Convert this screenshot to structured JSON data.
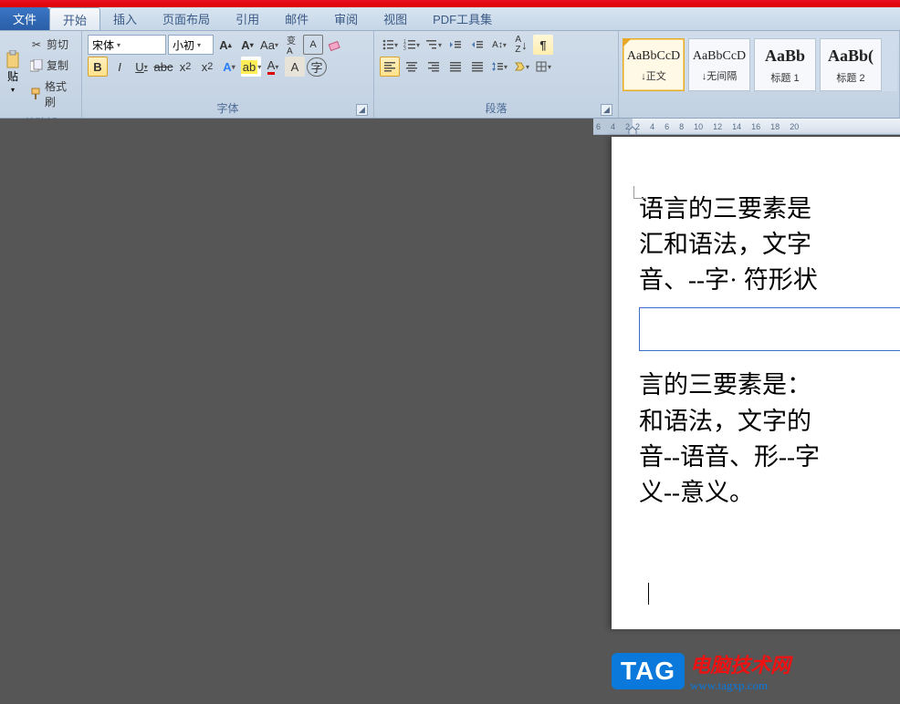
{
  "menu": {
    "file": "文件",
    "tabs": [
      "开始",
      "插入",
      "页面布局",
      "引用",
      "邮件",
      "审阅",
      "视图",
      "PDF工具集"
    ]
  },
  "clipboard": {
    "cut": "剪切",
    "copy": "复制",
    "paste": "贴",
    "format_painter": "格式刷",
    "group_label": "剪贴板"
  },
  "font": {
    "name": "宋体",
    "size": "小初",
    "group_label": "字体"
  },
  "paragraph": {
    "group_label": "段落"
  },
  "styles": [
    {
      "preview": "AaBbCcD",
      "name": "↓正文",
      "selected": true
    },
    {
      "preview": "AaBbCcD",
      "name": "↓无间隔",
      "selected": false
    },
    {
      "preview": "AaBb",
      "name": "标题 1",
      "big": true
    },
    {
      "preview": "AaBb(",
      "name": "标题 2",
      "big": true
    }
  ],
  "ruler": {
    "neg": [
      "6",
      "4",
      "2"
    ],
    "pos": [
      "2",
      "4",
      "6",
      "8",
      "10",
      "12",
      "14",
      "16",
      "18",
      "20"
    ]
  },
  "document": {
    "p1": [
      "语言的三要素是",
      "汇和语法，文字",
      "音、--字· 符形状"
    ],
    "p2": [
      "言的三要素是：",
      "和语法，文字的",
      "音--语音、形--字",
      "义--意义。"
    ]
  },
  "watermark": {
    "badge": "TAG",
    "title": "电脑技术网",
    "url": "www.tagxp.com"
  }
}
